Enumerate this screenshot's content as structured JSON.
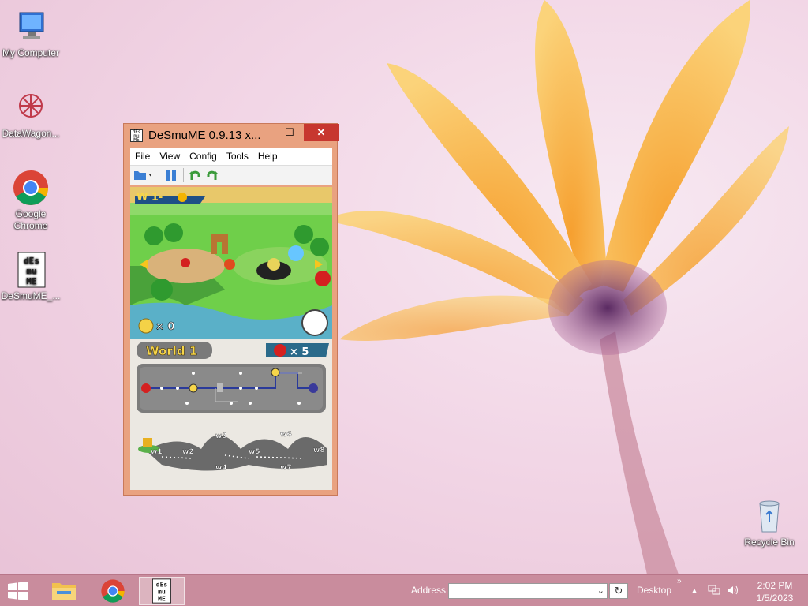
{
  "desktop": {
    "icons": [
      {
        "label": "My Computer"
      },
      {
        "label": "DataWagon..."
      },
      {
        "label": "Google Chrome"
      },
      {
        "label": "DeSmuME_..."
      },
      {
        "label": "Recycle Bin"
      }
    ]
  },
  "window": {
    "title": "DeSmuME 0.9.13 x...",
    "app_icon_text": "DeSmuME",
    "controls": {
      "minimize": "—",
      "maximize": "☐",
      "close": "✕"
    },
    "menu": [
      "File",
      "View",
      "Config",
      "Tools",
      "Help"
    ],
    "game": {
      "level_label": "W 1-",
      "coin_count": "× 0",
      "world_label": "World 1",
      "lives": "× 5",
      "worlds": [
        "w1",
        "w2",
        "w3",
        "w4",
        "w5",
        "w6",
        "w7",
        "w8"
      ]
    }
  },
  "taskbar": {
    "address_label": "Address",
    "address_value": "",
    "desktop_label": "Desktop",
    "overflow": "»",
    "time": "2:02 PM",
    "date": "1/5/2023"
  },
  "colors": {
    "taskbar": "#c98c9d",
    "window_frame": "#e9a280",
    "close_button": "#c7372f"
  }
}
